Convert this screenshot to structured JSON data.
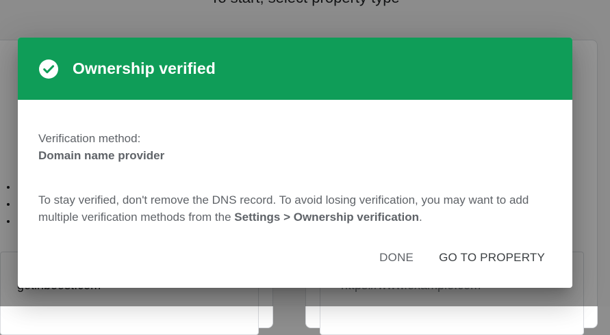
{
  "background": {
    "heading": "To start, select property type",
    "left_card_input": "getinboost.com",
    "right_card_input": "https://www.example.com"
  },
  "dialog": {
    "title": "Ownership verified",
    "header_color": "#0f9d58",
    "status_icon": "check-circle-icon",
    "method_label": "Verification method:",
    "method_value": "Domain name provider",
    "note_prefix": "To stay verified, don't remove the DNS record. To avoid losing verification, you may want to add multiple verification methods from the ",
    "note_link": "Settings > Ownership verification",
    "note_suffix": ".",
    "done_label": "DONE",
    "go_label": "GO TO PROPERTY"
  }
}
